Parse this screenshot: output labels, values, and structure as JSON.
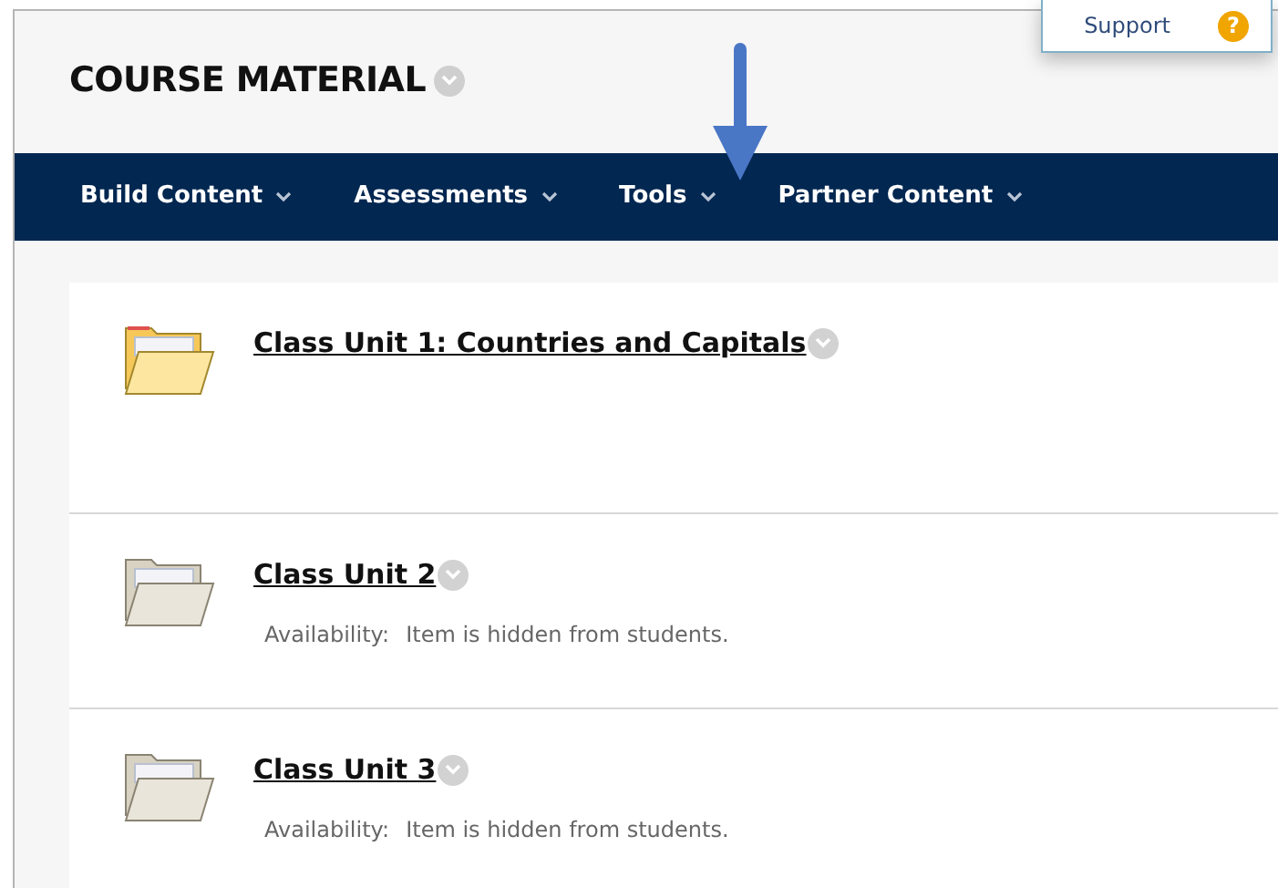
{
  "support": {
    "label": "Support",
    "icon": "?"
  },
  "page_title": "COURSE MATERIAL",
  "menu": [
    {
      "label": "Build Content"
    },
    {
      "label": "Assessments"
    },
    {
      "label": "Tools"
    },
    {
      "label": "Partner Content"
    }
  ],
  "items": [
    {
      "title": "Class Unit 1: Countries and Capitals",
      "hidden": false
    },
    {
      "title": "Class Unit 2",
      "hidden": true,
      "availability_label": "Availability:",
      "availability": "Item is hidden from students."
    },
    {
      "title": "Class Unit 3",
      "hidden": true,
      "availability_label": "Availability:",
      "availability": "Item is hidden from students."
    }
  ]
}
